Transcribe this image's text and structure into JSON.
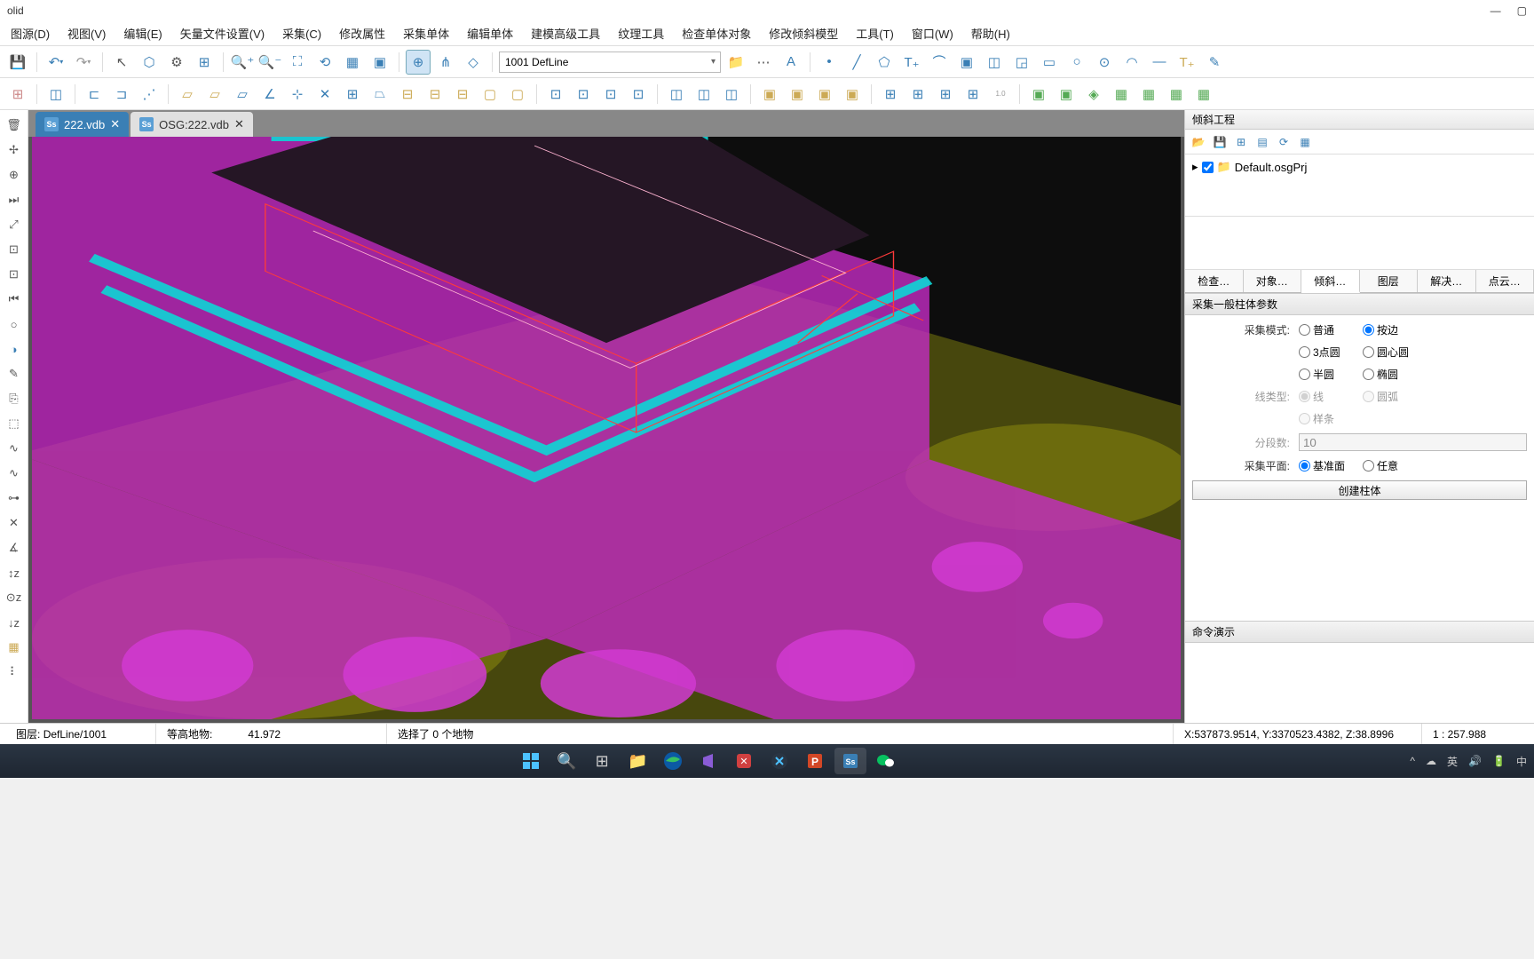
{
  "window": {
    "title": "olid"
  },
  "menubar": [
    {
      "label": "图源(D)"
    },
    {
      "label": "视图(V)"
    },
    {
      "label": "编辑(E)"
    },
    {
      "label": "矢量文件设置(V)"
    },
    {
      "label": "采集(C)"
    },
    {
      "label": "修改属性"
    },
    {
      "label": "采集单体"
    },
    {
      "label": "编辑单体"
    },
    {
      "label": "建模高级工具"
    },
    {
      "label": "纹理工具"
    },
    {
      "label": "检查单体对象"
    },
    {
      "label": "修改倾斜模型"
    },
    {
      "label": "工具(T)"
    },
    {
      "label": "窗口(W)"
    },
    {
      "label": "帮助(H)"
    }
  ],
  "toolbar1": {
    "combo": "1001 DefLine"
  },
  "tabs": [
    {
      "label": "222.vdb",
      "active": true
    },
    {
      "label": "OSG:222.vdb",
      "active": false
    }
  ],
  "right": {
    "title": "倾斜工程",
    "tree_item": "Default.osgPrj",
    "tabs": [
      "检查…",
      "对象…",
      "倾斜…",
      "图层",
      "解决…",
      "点云…"
    ],
    "active_tab": 2,
    "section": "采集一般柱体参数",
    "form": {
      "mode_label": "采集模式:",
      "mode_opts": [
        "普通",
        "按边",
        "3点圆",
        "圆心圆",
        "半圆",
        "椭圆"
      ],
      "mode_sel": 1,
      "line_label": "线类型:",
      "line_opts": [
        "线",
        "圆弧",
        "样条"
      ],
      "line_sel": 0,
      "seg_label": "分段数:",
      "seg_val": "10",
      "plane_label": "采集平面:",
      "plane_opts": [
        "基准面",
        "任意"
      ],
      "plane_sel": 0,
      "button": "创建柱体"
    },
    "cmd_title": "命令演示"
  },
  "status": {
    "layer_label": "图层:",
    "layer_val": "DefLine/1001",
    "height_label": "等高地物:",
    "height_val": "41.972",
    "sel": "选择了 0 个地物",
    "coord": "X:537873.9514, Y:3370523.4382, Z:38.8996",
    "scale": "1 : 257.988"
  },
  "tray": {
    "ime": "英",
    "ime2": "中"
  }
}
